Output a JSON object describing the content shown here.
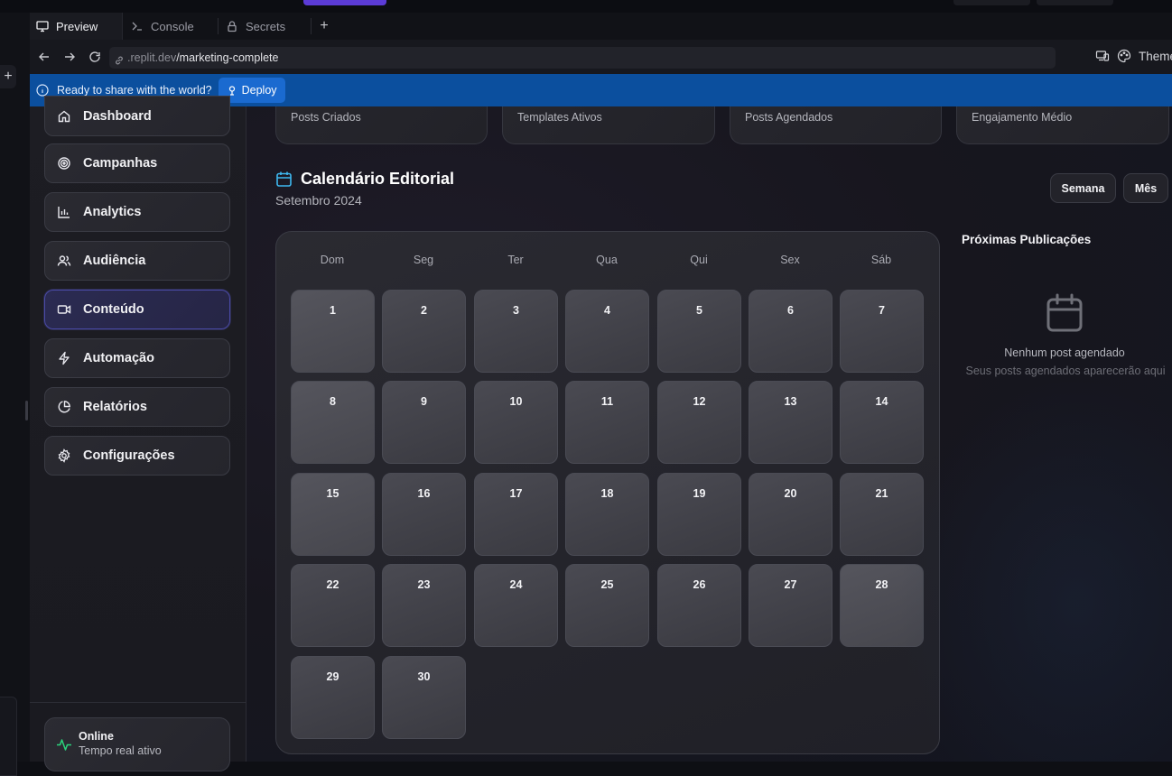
{
  "tabs": [
    {
      "label": "Preview",
      "icon": "monitor-icon"
    },
    {
      "label": "Console",
      "icon": "terminal-icon"
    },
    {
      "label": "Secrets",
      "icon": "lock-icon"
    }
  ],
  "urlbar": {
    "host": ".replit.dev",
    "path": "/marketing-complete",
    "theme_label": "Theme"
  },
  "deploy_banner": {
    "message": "Ready to share with the world?",
    "button_label": "Deploy"
  },
  "sidebar": {
    "items": [
      {
        "label": "Dashboard",
        "icon": "home-icon"
      },
      {
        "label": "Campanhas",
        "icon": "target-icon"
      },
      {
        "label": "Analytics",
        "icon": "bar-chart-icon"
      },
      {
        "label": "Audiência",
        "icon": "users-icon"
      },
      {
        "label": "Conteúdo",
        "icon": "video-icon",
        "active": true
      },
      {
        "label": "Automação",
        "icon": "zap-icon"
      },
      {
        "label": "Relatórios",
        "icon": "pie-chart-icon"
      },
      {
        "label": "Configurações",
        "icon": "gear-icon"
      }
    ],
    "status": {
      "title": "Online",
      "subtitle": "Tempo real ativo"
    }
  },
  "stats": [
    "Posts Criados",
    "Templates Ativos",
    "Posts Agendados",
    "Engajamento Médio"
  ],
  "calendar": {
    "title": "Calendário Editorial",
    "subtitle": "Setembro 2024",
    "view_week": "Semana",
    "view_month": "Mês",
    "weekdays": [
      "Dom",
      "Seg",
      "Ter",
      "Qua",
      "Qui",
      "Sex",
      "Sáb"
    ],
    "days": [
      "1",
      "2",
      "3",
      "4",
      "5",
      "6",
      "7",
      "8",
      "9",
      "10",
      "11",
      "12",
      "13",
      "14",
      "15",
      "16",
      "17",
      "18",
      "19",
      "20",
      "21",
      "22",
      "23",
      "24",
      "25",
      "26",
      "27",
      "28",
      "29",
      "30"
    ]
  },
  "upcoming": {
    "title": "Próximas Publicações",
    "empty_title": "Nenhum post agendado",
    "empty_subtitle": "Seus posts agendados aparecerão aqui"
  },
  "colors": {
    "accent": "#5b3bd6",
    "deploy_bar": "#0b4f9e",
    "online": "#2bd47c",
    "calendar_icon": "#3eb8f0"
  }
}
